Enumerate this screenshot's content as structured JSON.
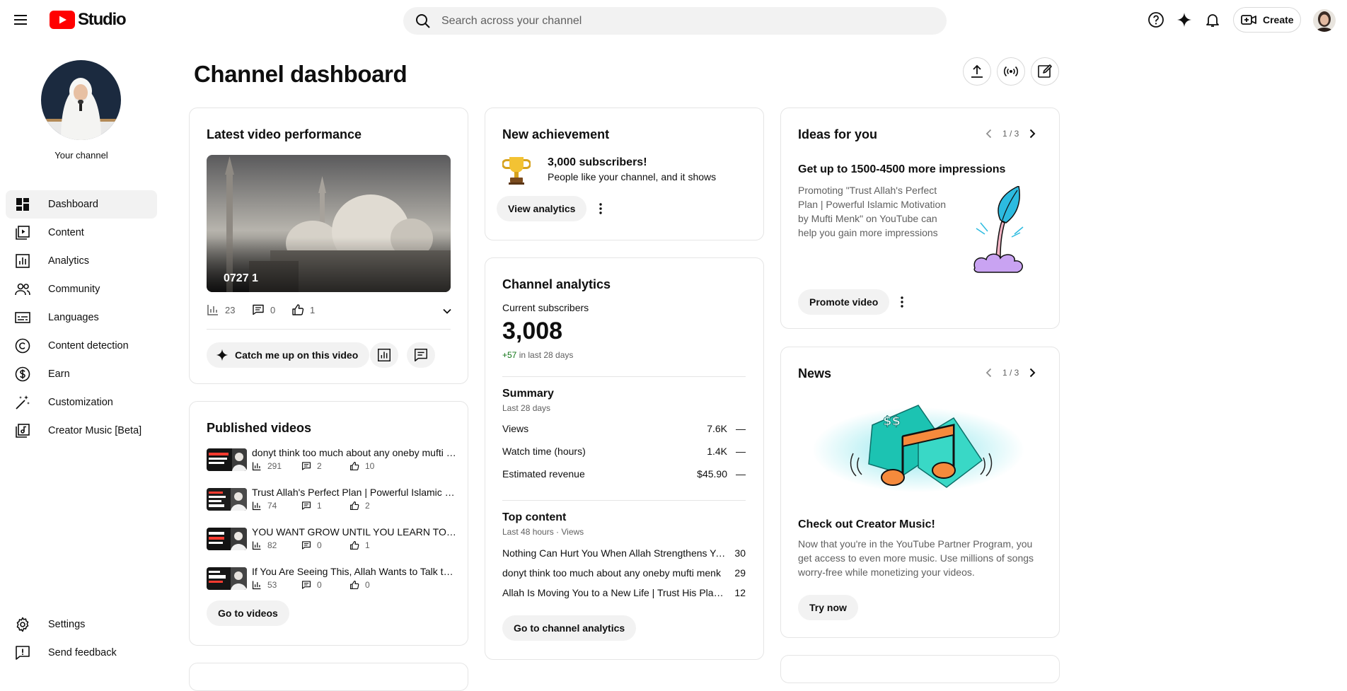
{
  "app": {
    "logo_text": "Studio"
  },
  "search": {
    "placeholder": "Search across your channel"
  },
  "header": {
    "create_label": "Create"
  },
  "sidebar": {
    "channel_label": "Your channel",
    "items": [
      {
        "label": "Dashboard"
      },
      {
        "label": "Content"
      },
      {
        "label": "Analytics"
      },
      {
        "label": "Community"
      },
      {
        "label": "Languages"
      },
      {
        "label": "Content detection"
      },
      {
        "label": "Earn"
      },
      {
        "label": "Customization"
      },
      {
        "label": "Creator Music [Beta]"
      }
    ],
    "bottom": [
      {
        "label": "Settings"
      },
      {
        "label": "Send feedback"
      }
    ]
  },
  "main": {
    "title": "Channel dashboard"
  },
  "latest": {
    "title": "Latest video performance",
    "video_title": "0727 1",
    "views": "23",
    "comments": "0",
    "likes": "1",
    "catch_up_label": "Catch me up on this video"
  },
  "published": {
    "title": "Published videos",
    "videos": [
      {
        "title": "donyt think too much about any oneby mufti menk",
        "views": "291",
        "comments": "2",
        "likes": "10",
        "thumb_text": "TOO MUCH ANY ONE"
      },
      {
        "title": "Trust Allah's Perfect Plan | Powerful Islamic Motivation by Mufti Menk",
        "views": "74",
        "comments": "1",
        "likes": "2",
        "thumb_text": "TRUST ALLAH'S PLAN"
      },
      {
        "title": "YOU WANT GROW UNTIL YOU LEARN TO BE ALONE",
        "views": "82",
        "comments": "0",
        "likes": "1",
        "thumb_text": "GROW UNTIL"
      },
      {
        "title": "If You Are Seeing This, Allah Wants to Talk to You",
        "views": "53",
        "comments": "0",
        "likes": "0",
        "thumb_text": "IF YOU'RE ALLAH"
      }
    ],
    "go_label": "Go to videos"
  },
  "achievement": {
    "title": "New achievement",
    "headline": "3,000 subscribers!",
    "sub": "People like your channel, and it shows",
    "button": "View analytics"
  },
  "analytics": {
    "title": "Channel analytics",
    "subs_label": "Current subscribers",
    "subs_value": "3,008",
    "subs_delta": "+57",
    "subs_delta_suffix": " in last 28 days",
    "summary_title": "Summary",
    "summary_period": "Last 28 days",
    "rows": [
      {
        "label": "Views",
        "value": "7.6K",
        "trend": "—"
      },
      {
        "label": "Watch time (hours)",
        "value": "1.4K",
        "trend": "—"
      },
      {
        "label": "Estimated revenue",
        "value": "$45.90",
        "trend": "—"
      }
    ],
    "top_title": "Top content",
    "top_period": "Last 48 hours · Views",
    "top": [
      {
        "title": "Nothing Can Hurt You When Allah Strengthens You | Mufti Menk",
        "views": "30"
      },
      {
        "title": "donyt think too much about any oneby mufti menk",
        "views": "29"
      },
      {
        "title": "Allah Is Moving You to a New Life | Trust His Plan | Mufti Menk",
        "views": "12"
      }
    ],
    "go_label": "Go to channel analytics"
  },
  "ideas": {
    "title": "Ideas for you",
    "pager": "1 / 3",
    "headline": "Get up to 1500-4500 more impressions",
    "body": "Promoting \"Trust Allah's Perfect Plan | Powerful Islamic Motivation by Mufti Menk\" on YouTube can help you gain more impressions",
    "button": "Promote video"
  },
  "news": {
    "title": "News",
    "pager": "1 / 3",
    "headline": "Check out Creator Music!",
    "body": "Now that you're in the YouTube Partner Program, you get access to even more music. Use millions of songs worry-free while monetizing your videos.",
    "button": "Try now"
  },
  "colors": {
    "brand_red": "#ff0000",
    "positive_green": "#107516",
    "pill_bg": "#f2f2f2",
    "border": "#e5e5e5"
  }
}
